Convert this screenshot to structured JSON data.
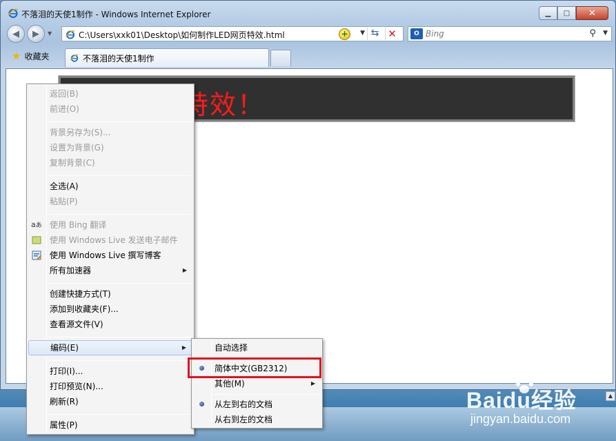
{
  "window": {
    "title": "不落泪的天使1制作 - Windows Internet Explorer"
  },
  "address_bar": {
    "url": "C:\\Users\\xxk01\\Desktop\\如何制作LED网页特效.html"
  },
  "search": {
    "placeholder": "Bing",
    "provider_icon": "outlook-icon"
  },
  "favorites": {
    "label": "收藏夹"
  },
  "tab": {
    "label": "不落泪的天使1制作"
  },
  "page": {
    "led_text": "特效！"
  },
  "context_menu": {
    "back": "返回(B)",
    "forward": "前进(O)",
    "save_background": "背景另存为(S)...",
    "set_background": "设置为背景(G)",
    "copy_background": "复制背景(C)",
    "select_all": "全选(A)",
    "paste": "粘贴(P)",
    "bing_translate": "使用 Bing 翻译",
    "live_email": "使用 Windows Live 发送电子邮件",
    "live_blog": "使用 Windows Live 撰写博客",
    "all_accelerators": "所有加速器",
    "create_shortcut": "创建快捷方式(T)",
    "add_favorites": "添加到收藏夹(F)...",
    "view_source": "查看源文件(V)",
    "encoding": "编码(E)",
    "print": "打印(I)...",
    "print_preview": "打印预览(N)...",
    "refresh": "刷新(R)",
    "properties": "属性(P)"
  },
  "encoding_submenu": {
    "auto_select": "自动选择",
    "gb2312": "简体中文(GB2312)",
    "other": "其他(M)",
    "ltr": "从左到右的文档",
    "rtl": "从右到左的文档"
  },
  "watermark": {
    "logo": "Baidu经验",
    "url": "jingyan.baidu.com"
  },
  "colors": {
    "led_text": "#ff1a1a",
    "led_bg": "#303030",
    "highlight_box": "#e0121a"
  }
}
